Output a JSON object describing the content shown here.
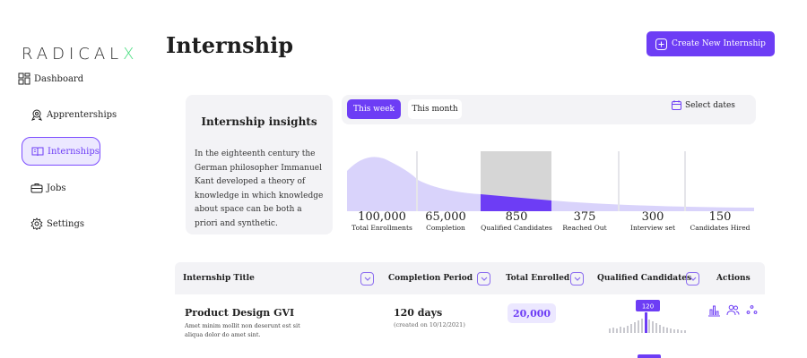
{
  "logo": {
    "prefix": "RADICAL",
    "suffix": "X"
  },
  "sidebar": {
    "items": [
      {
        "label": "Dashboard",
        "icon": "dashboard-icon"
      },
      {
        "label": "Apprenterships",
        "icon": "award-icon"
      },
      {
        "label": "Internships",
        "icon": "book-icon",
        "active": true
      },
      {
        "label": "Jobs",
        "icon": "briefcase-icon"
      },
      {
        "label": "Settings",
        "icon": "gear-icon"
      }
    ]
  },
  "header": {
    "title": "Internship",
    "create_button": "Create New Internship"
  },
  "insights": {
    "title": "Internship insights",
    "body": "In the eighteenth century the German philosopher Immanuel Kant developed a theory of knowledge in which knowledge about space can be both a priori and synthetic."
  },
  "chart_panel": {
    "tabs": [
      "This week",
      "This month"
    ],
    "active_tab": "This week",
    "select_dates": "Select dates"
  },
  "chart_data": {
    "type": "area",
    "categories": [
      "Total Enrollments",
      "Completion",
      "Qualified Candidates",
      "Reached Out",
      "Interview set",
      "Candidates Hired"
    ],
    "values": [
      100000,
      65000,
      850,
      375,
      300,
      150
    ],
    "value_labels": [
      "100,000",
      "65,000",
      "850",
      "375",
      "300",
      "150"
    ],
    "highlighted": "Qualified Candidates",
    "colors": {
      "area": "#d9d3fb",
      "highlight": "#6d3df5",
      "highlight_bg": "#d6d6d6"
    }
  },
  "table": {
    "headers": [
      "Internship Title",
      "Completion Period",
      "Total Enrolled",
      "Qualified Candidates",
      "Actions"
    ],
    "rows": [
      {
        "title": "Product Design GVI",
        "description": "Amet minim mollit non deserunt est sit aliqua dolor do amet sint.",
        "period": "120 days",
        "created": "(created on 10/12/2021)",
        "enrolled": "20,000",
        "qualified_badge": "120"
      }
    ]
  },
  "colors": {
    "accent": "#6d3df5",
    "accent_light": "#ece8ff",
    "panel": "#f3f3f6",
    "logo_x": "#4ade80"
  }
}
